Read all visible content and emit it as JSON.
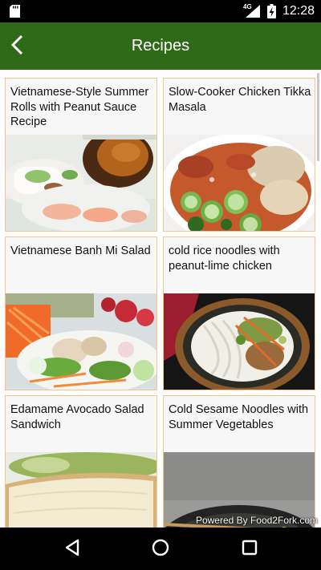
{
  "status_bar": {
    "network": "4G",
    "time": "12:28",
    "icons": [
      "sd-card-icon",
      "signal-icon",
      "battery-charging-icon"
    ]
  },
  "app_bar": {
    "title": "Recipes",
    "back_icon": "back-arrow-icon",
    "color": "#2e6a18"
  },
  "recipes": [
    {
      "title": "Vietnamese-Style Summer Rolls with Peanut Sauce Recipe"
    },
    {
      "title": "Slow-Cooker Chicken Tikka Masala"
    },
    {
      "title": "Vietnamese Banh Mi Salad"
    },
    {
      "title": "cold rice noodles with peanut-lime chicken"
    },
    {
      "title": "Edamame Avocado Salad Sandwich"
    },
    {
      "title": "Cold Sesame Noodles with Summer Vegetables"
    }
  ],
  "watermark": "Powered By Food2Fork.com",
  "nav_bar": {
    "icons": [
      "back-triangle-icon",
      "home-circle-icon",
      "recents-square-icon"
    ]
  },
  "colors": {
    "card_border": "#f5c78e",
    "card_background": "#f7f7f7"
  }
}
